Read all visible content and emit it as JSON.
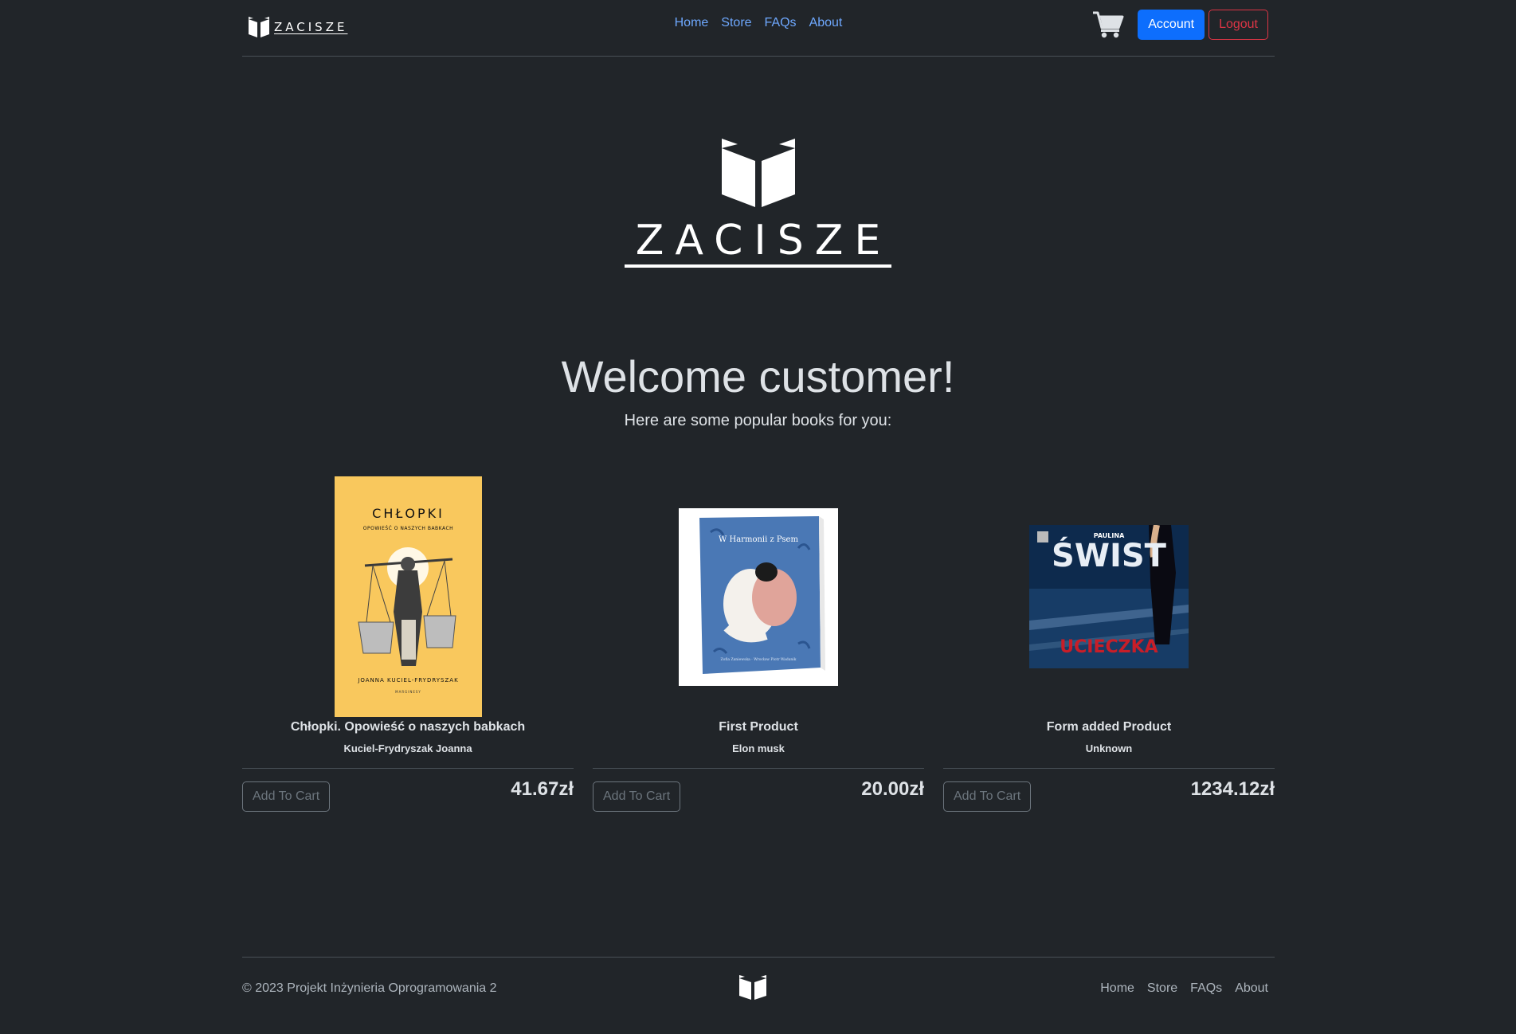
{
  "header": {
    "brand": "ZACISZE",
    "nav": [
      "Home",
      "Store",
      "FAQs",
      "About"
    ],
    "account_label": "Account",
    "logout_label": "Logout"
  },
  "hero": {
    "logo_text": "ZACISZE",
    "title": "Welcome customer!",
    "subtitle": "Here are some popular books for you:"
  },
  "products": [
    {
      "title": "Chłopki. Opowieść o naszych babkach",
      "author": "Kuciel-Frydryszak Joanna",
      "price": "41.67zł",
      "button": "Add To Cart",
      "cover": {
        "title": "CHŁOPKI",
        "subtitle": "OPOWIEŚĆ O NASZYCH BABKACH",
        "author": "JOANNA KUCIEL-FRYDRYSZAK",
        "publisher": "MARGINESY",
        "color": "#f9c85d"
      }
    },
    {
      "title": "First Product",
      "author": "Elon musk",
      "price": "20.00zł",
      "button": "Add To Cart",
      "cover": {
        "title": "W Harmonii z Psem",
        "author": "Zofia Zaniewska · Wrocław Piotr Wadanik",
        "color": "#4a78b5"
      }
    },
    {
      "title": "Form added Product",
      "author": "Unknown",
      "price": "1234.12zł",
      "button": "Add To Cart",
      "cover": {
        "author": "PAULINA",
        "title": "ŚWIST",
        "subtitle": "UCIECZKA",
        "color": "#0d2a4d"
      }
    }
  ],
  "footer": {
    "copyright": "© 2023 Projekt Inżynieria Oprogramowania 2",
    "nav": [
      "Home",
      "Store",
      "FAQs",
      "About"
    ]
  },
  "colors": {
    "background": "#212529",
    "primary": "#0d6efd",
    "danger": "#dc3545",
    "link": "#6ea8fe"
  },
  "icons": {
    "brand": "open-book-icon",
    "cart": "shopping-cart-icon"
  }
}
